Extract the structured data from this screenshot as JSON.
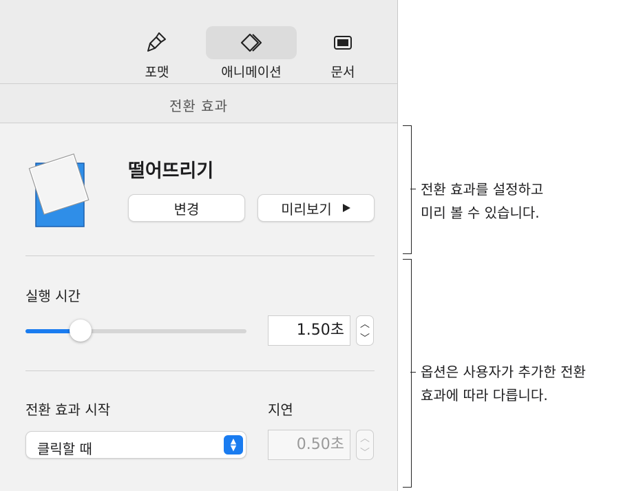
{
  "toolbar": {
    "format_label": "포맷",
    "animate_label": "애니메이션",
    "document_label": "문서"
  },
  "section_title": "전환 효과",
  "transition": {
    "name": "떨어뜨리기",
    "change_label": "변경",
    "preview_label": "미리보기",
    "preview_icon": "play-icon"
  },
  "duration": {
    "label": "실행 시간",
    "value": "1.50초",
    "slider_fraction": 0.25
  },
  "start": {
    "label": "전환 효과 시작",
    "selected": "클릭할 때"
  },
  "delay": {
    "label": "지연",
    "value": "0.50초"
  },
  "callouts": {
    "top_line1": "전환 효과를 설정하고",
    "top_line2": "미리 볼 수 있습니다.",
    "bottom_line1": "옵션은 사용자가 추가한 전환",
    "bottom_line2": "효과에 따라 다릅니다."
  },
  "colors": {
    "accent": "#1a7cf0",
    "panel": "#ececec"
  }
}
